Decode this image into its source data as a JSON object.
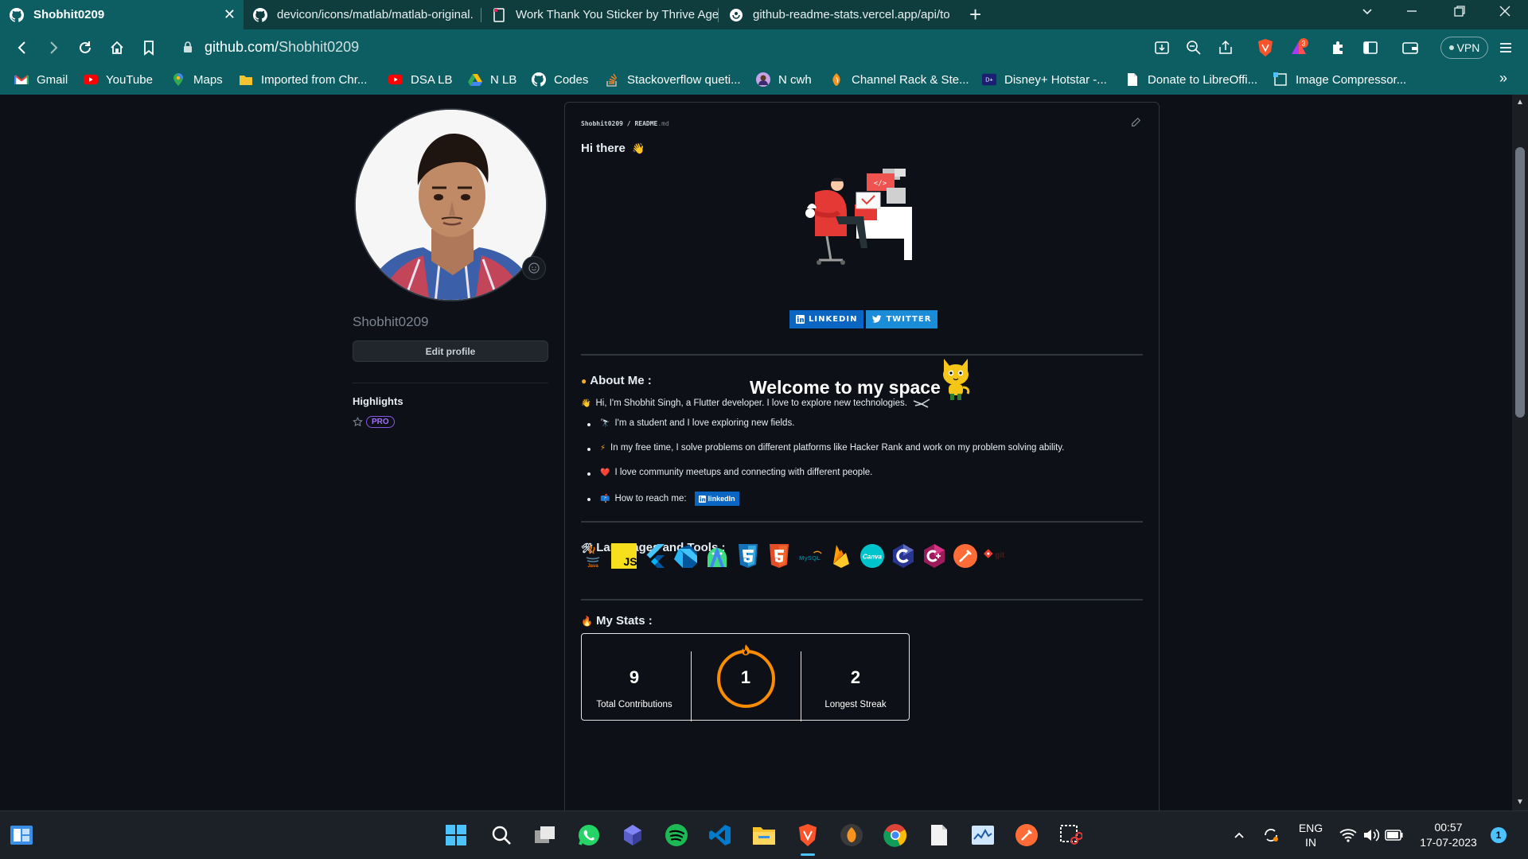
{
  "browser": {
    "tabs": [
      {
        "label": "Shobhit0209",
        "icon": "github-icon",
        "active": true
      },
      {
        "label": "devicon/icons/matlab/matlab-original.",
        "icon": "github-icon",
        "active": false
      },
      {
        "label": "Work Thank You Sticker by Thrive Agency",
        "icon": "document-icon",
        "active": false
      },
      {
        "label": "github-readme-stats.vercel.app/api/to",
        "icon": "globe-icon",
        "active": false
      }
    ],
    "close_glyph": "✕",
    "new_tab_glyph": "+",
    "url_host": "github.com/",
    "url_path": "Shobhit0209",
    "vpn_label": "VPN",
    "brave_badge_count": "3"
  },
  "bookmarks": [
    {
      "label": "Gmail",
      "icon": "gmail-icon"
    },
    {
      "label": "YouTube",
      "icon": "youtube-icon"
    },
    {
      "label": "Maps",
      "icon": "maps-icon"
    },
    {
      "label": "Imported from Chr...",
      "icon": "folder-icon"
    },
    {
      "label": "DSA LB",
      "icon": "youtube-icon"
    },
    {
      "label": "N LB",
      "icon": "drive-icon"
    },
    {
      "label": "Codes",
      "icon": "github-icon"
    },
    {
      "label": "Stackoverflow queti...",
      "icon": "stackoverflow-icon"
    },
    {
      "label": "N cwh",
      "icon": "avatar-icon"
    },
    {
      "label": "Channel Rack & Ste...",
      "icon": "fl-studio-icon"
    },
    {
      "label": "Disney+ Hotstar -...",
      "icon": "hotstar-icon"
    },
    {
      "label": "Donate to LibreOffi...",
      "icon": "document-icon"
    },
    {
      "label": "Image Compressor...",
      "icon": "compress-icon"
    }
  ],
  "bookmarks_overflow": "»",
  "profile": {
    "username": "Shobhit0209",
    "edit_label": "Edit profile",
    "highlights_title": "Highlights",
    "pro_badge": "PRO"
  },
  "readme": {
    "path_user": "Shobhit0209",
    "path_sep": " / ",
    "path_file": "README",
    "path_ext": ".md",
    "greeting": "Hi there",
    "greeting_emoji": "👋",
    "linkedin_badge": "LINKEDIN",
    "twitter_badge": "TWITTER",
    "welcome": "Welcome to my space",
    "about_title": "About Me :",
    "about_intro": "Hi, I'm Shobhit Singh, a Flutter developer. I love to explore new technologies.",
    "about_items": [
      {
        "emoji": "🔭",
        "text": "I'm a student and I love exploring new fields."
      },
      {
        "emoji": "⚡",
        "text": "In my free time, I solve problems on different platforms like Hacker Rank and work on my problem solving ability."
      },
      {
        "emoji": "❤️",
        "text": "I love community meetups and connecting with different people."
      },
      {
        "emoji": "📫",
        "text": "How to reach me:"
      }
    ],
    "reach_badge": "linkedIn",
    "tools_title": "Languages and Tools :",
    "tools": [
      "java",
      "javascript",
      "flutter",
      "dart",
      "android-studio",
      "css3",
      "html5",
      "mysql",
      "firebase",
      "canva",
      "c",
      "cplusplus",
      "postman",
      "git"
    ],
    "stats_title": "My Stats :",
    "stats": {
      "total_contributions": "9",
      "total_contributions_label": "Total Contributions",
      "current_streak": "1",
      "longest_streak": "2",
      "longest_streak_label": "Longest Streak"
    }
  },
  "taskbar": {
    "apps": [
      "start-icon",
      "search-icon",
      "task-view-icon",
      "whatsapp-icon",
      "copilot-icon",
      "spotify-icon",
      "vscode-icon",
      "file-explorer-icon",
      "brave-icon",
      "fl-studio-icon",
      "chrome-icon",
      "notepad-icon",
      "task-manager-icon",
      "postman-icon",
      "snipping-tool-icon"
    ],
    "lang_top": "ENG",
    "lang_bottom": "IN",
    "time": "00:57",
    "date": "17-07-2023",
    "notification_count": "1"
  },
  "colors": {
    "tab_bar": "#0f3d3e",
    "toolbar": "#0c5e63",
    "page_bg": "#0d1117",
    "linkedin": "#0a66c2",
    "twitter": "#1a8cd8",
    "streak": "#fb8c00"
  }
}
